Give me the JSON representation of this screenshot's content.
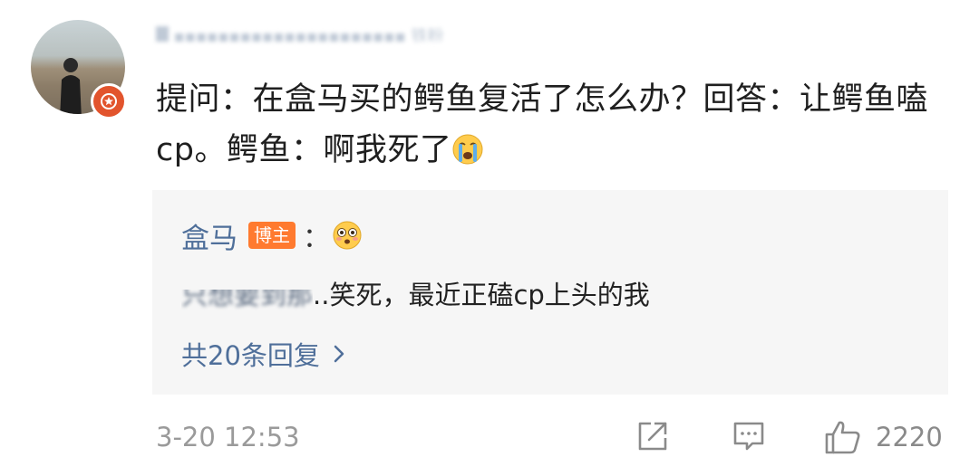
{
  "comment": {
    "username_obscured": "█ ▪▪▪▪▪▪▪▪▪▪▪▪▪▪▪▪▪▪▪▪▪ 铁粉",
    "text_part1": "提问：在盒马买的鳄鱼复活了怎么办？回答：让鳄鱼嗑cp。鳄鱼：啊我死了",
    "emoji": "crying-face",
    "timestamp": "3-20 12:53",
    "like_count": "2220"
  },
  "reply": {
    "author": "盒马",
    "tag": "博主",
    "colon": "：",
    "emoji": "flushed-face",
    "text_faded": "只想要到那",
    "text": "..笑死，最近正磕cp上头的我",
    "more_label": "共20条回复"
  },
  "colors": {
    "link_blue": "#4f6f9a",
    "tag_orange": "#ff7a2f",
    "badge_red": "#e2542d",
    "meta_gray": "#9a9a9a",
    "reply_bg": "#f6f6f6"
  },
  "icons": {
    "share": "share-icon",
    "comment": "comment-icon",
    "like": "thumbs-up-icon",
    "chevron": "chevron-right-icon",
    "badge": "star-badge-icon"
  }
}
